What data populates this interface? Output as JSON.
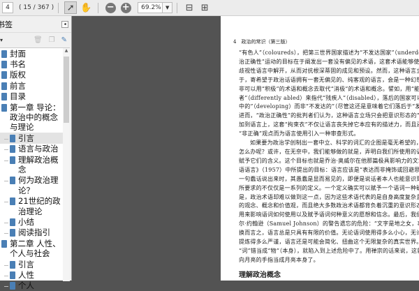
{
  "toolbar": {
    "page": "4",
    "count": "( 15 / 367 )",
    "zoom": "69.2%"
  },
  "sidebar": {
    "title": "书签",
    "items": [
      {
        "label": "封面",
        "level": 1
      },
      {
        "label": "书名",
        "level": 1
      },
      {
        "label": "版权",
        "level": 1
      },
      {
        "label": "前言",
        "level": 1
      },
      {
        "label": "目录",
        "level": 1
      },
      {
        "label": "第一章 导论：政治中的概念与理论",
        "level": 1
      },
      {
        "label": "引言",
        "level": 2,
        "selected": true
      },
      {
        "label": "语言与政治",
        "level": 2
      },
      {
        "label": "理解政治概念",
        "level": 2
      },
      {
        "label": "何为政治理论？",
        "level": 2
      },
      {
        "label": "21世纪的政治理论",
        "level": 2
      },
      {
        "label": "小结",
        "level": 2
      },
      {
        "label": "阅读指引",
        "level": 2
      },
      {
        "label": "第二章 人性、个人与社会",
        "level": 1
      },
      {
        "label": "引言",
        "level": 2
      },
      {
        "label": "人性",
        "level": 2
      },
      {
        "label": "个人",
        "level": 2
      }
    ]
  },
  "document": {
    "running_head": "4　政治的常识（第三版）",
    "lines": [
      "“有色人”（coloureds），把第三世界国家描述为“不发达国家”（underdeveloped），等等。“政",
      "治正确性”运动的目标在于阐发出一套没有偏见的术语，这套术语能够使政治论辩和社会生活从",
      "歧视性语言中解开，从而对抗根深蒂固的成见和预设。然而，这种语言立场的困难之处在",
      "于，寄希望于政治话语拥有一套无偏见的、纯客观的语言，会是一种幻想。充其量，人们",
      "非可以用“积极”的术语和概念去取代“消极”的术语和概念。譬如，用“能力有差异的人",
      "者”（differently abled）来指代“残疾人”（disabled），落后的国家可以被描述为“发展",
      "中的”（developing）而非“不发达的”（尽管这还是意味着它们落后于“发达”国家）。",
      "进而，“政治正确性”的批判者们认为，这种语言立场只会把意识形态的“拘束衣”强",
      "加到语言上，这套“拘束衣”不仅让语言丧失掉它本应有的描述力，而且还要拒绝表达",
      "“非正确”观点而为语言使用引入一种审查形式。",
      "如果要为政治学创制出一套中立、科学的词汇的企图是毫无希望的，那么我们又应该",
      "怎么办呢？或许，在无奈中，我们能够做的就是，弄明白我们所使用的语词以及我们",
      "赋予它们的含义。这个目标也就是乔治·奥威尔在他那篇极具影响力的文章《政治与英",
      "语语言》（1957）中所提出的目标：语言应该是“表达而非掩饰或回避思想的工具”。当",
      "一句蠢话说出来时，其愚蠢是显而易见的，即便是说话者本人也能意识到。然而，这",
      "所要求的不仅仅是一系列的定义。一个定义确实可以赋予一个语词一种确切的含义，但",
      "是，政治术语却难以做到这一点，因为这些术语代表的是自身高度复杂且往往极具争议",
      "的观念、概念和价值观，而且绝大多数政治术语都背负着沉重的意识形态包袱。即便",
      "用来影响语词如何使用以及赋予语词何种意义的愿想和信念。最后，我们还有把塞缪",
      "尔·约翰逊（Samuel Johnson）的警告遗忘的危险：“文字是地之女，事物是天之子。”",
      "换而言之，语言总是只具有有限的价值。无论语词使用得多么小心，无论语词的含义",
      "提炼得多么严谨，语言还是可能会简化、扭曲这个无限复杂的真实世界。如果我们把",
      "“词”错当成“物”（本身），就陷入到上述危险中了。用禅宗的话来说，这就好比把指",
      "向月亮的手指当成月亮本身了。"
    ],
    "indented": [
      10
    ],
    "next_heading": "理解政治概念"
  }
}
